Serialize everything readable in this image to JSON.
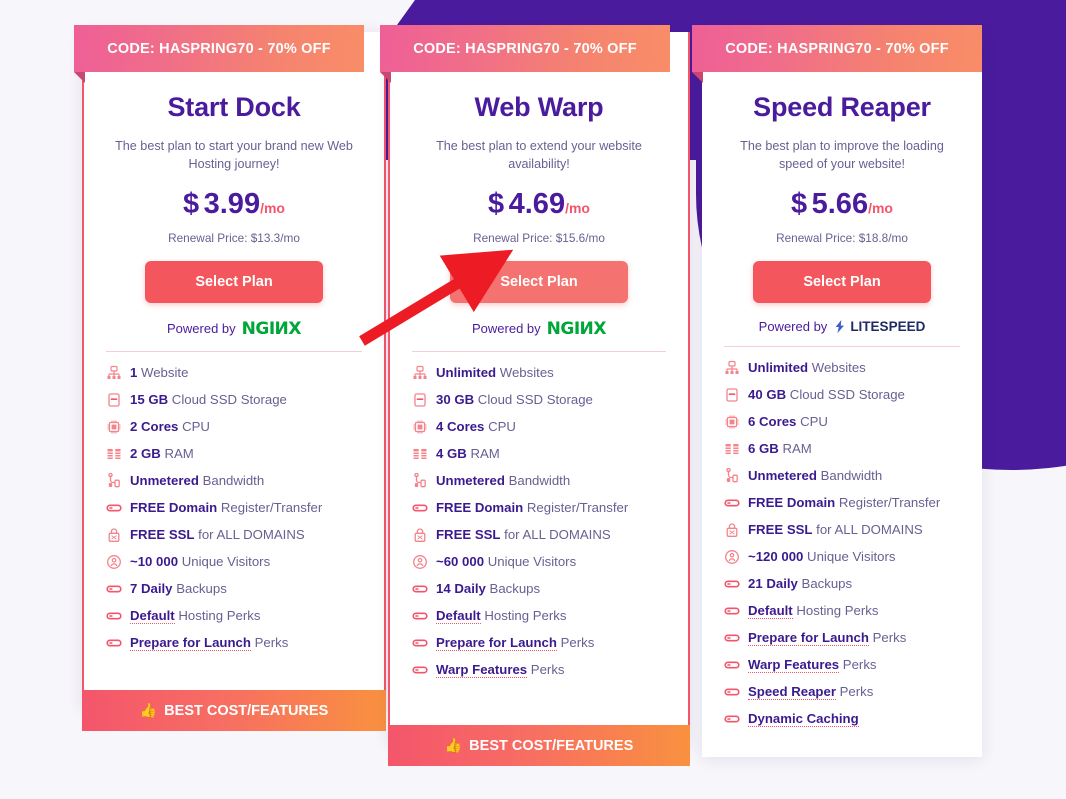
{
  "page": {
    "background_color": "#f7f6fa",
    "accent_purple": "#4a1b9d",
    "accent_red": "#f4556b"
  },
  "annotation": {
    "arrow_color": "#ed1b24",
    "points_to": "Select Plan button of Web Warp plan"
  },
  "plans": [
    {
      "ribbon": "CODE: HASPRING70 - 70% OFF",
      "title": "Start Dock",
      "description": "The best plan to start your brand new Web Hosting journey!",
      "price_currency": "$",
      "price_amount": "3.99",
      "price_period": "/mo",
      "renewal": "Renewal Price: $13.3/mo",
      "cta": "Select Plan",
      "powered_by_label": "Powered by",
      "powered_by_tech": "NGINX",
      "footer_badge": "BEST COST/FEATURES",
      "has_footer_badge": true,
      "features": [
        {
          "icon": "websites-icon",
          "strong": "1",
          "rest": "Website",
          "link": false
        },
        {
          "icon": "storage-icon",
          "strong": "15 GB",
          "rest": "Cloud SSD Storage",
          "link": false
        },
        {
          "icon": "cpu-icon",
          "strong": "2 Cores",
          "rest": "CPU",
          "link": false
        },
        {
          "icon": "ram-icon",
          "strong": "2 GB",
          "rest": "RAM",
          "link": false
        },
        {
          "icon": "bandwidth-icon",
          "strong": "Unmetered",
          "rest": "Bandwidth",
          "link": false
        },
        {
          "icon": "pill-icon",
          "strong": "FREE Domain",
          "rest": "Register/Transfer",
          "link": false
        },
        {
          "icon": "lock-icon",
          "strong": "FREE SSL",
          "rest": "for ALL DOMAINS",
          "link": false
        },
        {
          "icon": "visitors-icon",
          "strong": "~10 000",
          "rest": "Unique Visitors",
          "link": false
        },
        {
          "icon": "pill-icon",
          "strong": "7 Daily",
          "rest": "Backups",
          "link": false
        },
        {
          "icon": "pill-icon",
          "strong": "Default",
          "rest": "Hosting Perks",
          "link": true
        },
        {
          "icon": "pill-icon",
          "strong": "Prepare for Launch",
          "rest": "Perks",
          "link": true
        }
      ]
    },
    {
      "ribbon": "CODE: HASPRING70 - 70% OFF",
      "title": "Web Warp",
      "description": "The best plan to extend your website availability!",
      "price_currency": "$",
      "price_amount": "4.69",
      "price_period": "/mo",
      "renewal": "Renewal Price: $15.6/mo",
      "cta": "Select Plan",
      "powered_by_label": "Powered by",
      "powered_by_tech": "NGINX",
      "footer_badge": "BEST COST/FEATURES",
      "has_footer_badge": true,
      "features": [
        {
          "icon": "websites-icon",
          "strong": "Unlimited",
          "rest": "Websites",
          "link": false
        },
        {
          "icon": "storage-icon",
          "strong": "30 GB",
          "rest": "Cloud SSD Storage",
          "link": false
        },
        {
          "icon": "cpu-icon",
          "strong": "4 Cores",
          "rest": "CPU",
          "link": false
        },
        {
          "icon": "ram-icon",
          "strong": "4 GB",
          "rest": "RAM",
          "link": false
        },
        {
          "icon": "bandwidth-icon",
          "strong": "Unmetered",
          "rest": "Bandwidth",
          "link": false
        },
        {
          "icon": "pill-icon",
          "strong": "FREE Domain",
          "rest": "Register/Transfer",
          "link": false
        },
        {
          "icon": "lock-icon",
          "strong": "FREE SSL",
          "rest": "for ALL DOMAINS",
          "link": false
        },
        {
          "icon": "visitors-icon",
          "strong": "~60 000",
          "rest": "Unique Visitors",
          "link": false
        },
        {
          "icon": "pill-icon",
          "strong": "14 Daily",
          "rest": "Backups",
          "link": false
        },
        {
          "icon": "pill-icon",
          "strong": "Default",
          "rest": "Hosting Perks",
          "link": true
        },
        {
          "icon": "pill-icon",
          "strong": "Prepare for Launch",
          "rest": "Perks",
          "link": true
        },
        {
          "icon": "pill-icon",
          "strong": "Warp Features",
          "rest": "Perks",
          "link": true
        }
      ]
    },
    {
      "ribbon": "CODE: HASPRING70 - 70% OFF",
      "title": "Speed Reaper",
      "description": "The best plan to improve the loading speed of your website!",
      "price_currency": "$",
      "price_amount": "5.66",
      "price_period": "/mo",
      "renewal": "Renewal Price: $18.8/mo",
      "cta": "Select Plan",
      "powered_by_label": "Powered by",
      "powered_by_tech": "LITESPEED",
      "footer_badge": "",
      "has_footer_badge": false,
      "features": [
        {
          "icon": "websites-icon",
          "strong": "Unlimited",
          "rest": "Websites",
          "link": false
        },
        {
          "icon": "storage-icon",
          "strong": "40 GB",
          "rest": "Cloud SSD Storage",
          "link": false
        },
        {
          "icon": "cpu-icon",
          "strong": "6 Cores",
          "rest": "CPU",
          "link": false
        },
        {
          "icon": "ram-icon",
          "strong": "6 GB",
          "rest": "RAM",
          "link": false
        },
        {
          "icon": "bandwidth-icon",
          "strong": "Unmetered",
          "rest": "Bandwidth",
          "link": false
        },
        {
          "icon": "pill-icon",
          "strong": "FREE Domain",
          "rest": "Register/Transfer",
          "link": false
        },
        {
          "icon": "lock-icon",
          "strong": "FREE SSL",
          "rest": "for ALL DOMAINS",
          "link": false
        },
        {
          "icon": "visitors-icon",
          "strong": "~120 000",
          "rest": "Unique Visitors",
          "link": false
        },
        {
          "icon": "pill-icon",
          "strong": "21 Daily",
          "rest": "Backups",
          "link": false
        },
        {
          "icon": "pill-icon",
          "strong": "Default",
          "rest": "Hosting Perks",
          "link": true
        },
        {
          "icon": "pill-icon",
          "strong": "Prepare for Launch",
          "rest": "Perks",
          "link": true
        },
        {
          "icon": "pill-icon",
          "strong": "Warp Features",
          "rest": "Perks",
          "link": true
        },
        {
          "icon": "pill-icon",
          "strong": "Speed Reaper",
          "rest": "Perks",
          "link": true
        },
        {
          "icon": "pill-icon",
          "strong": "Dynamic Caching",
          "rest": "",
          "link": true
        }
      ]
    }
  ]
}
